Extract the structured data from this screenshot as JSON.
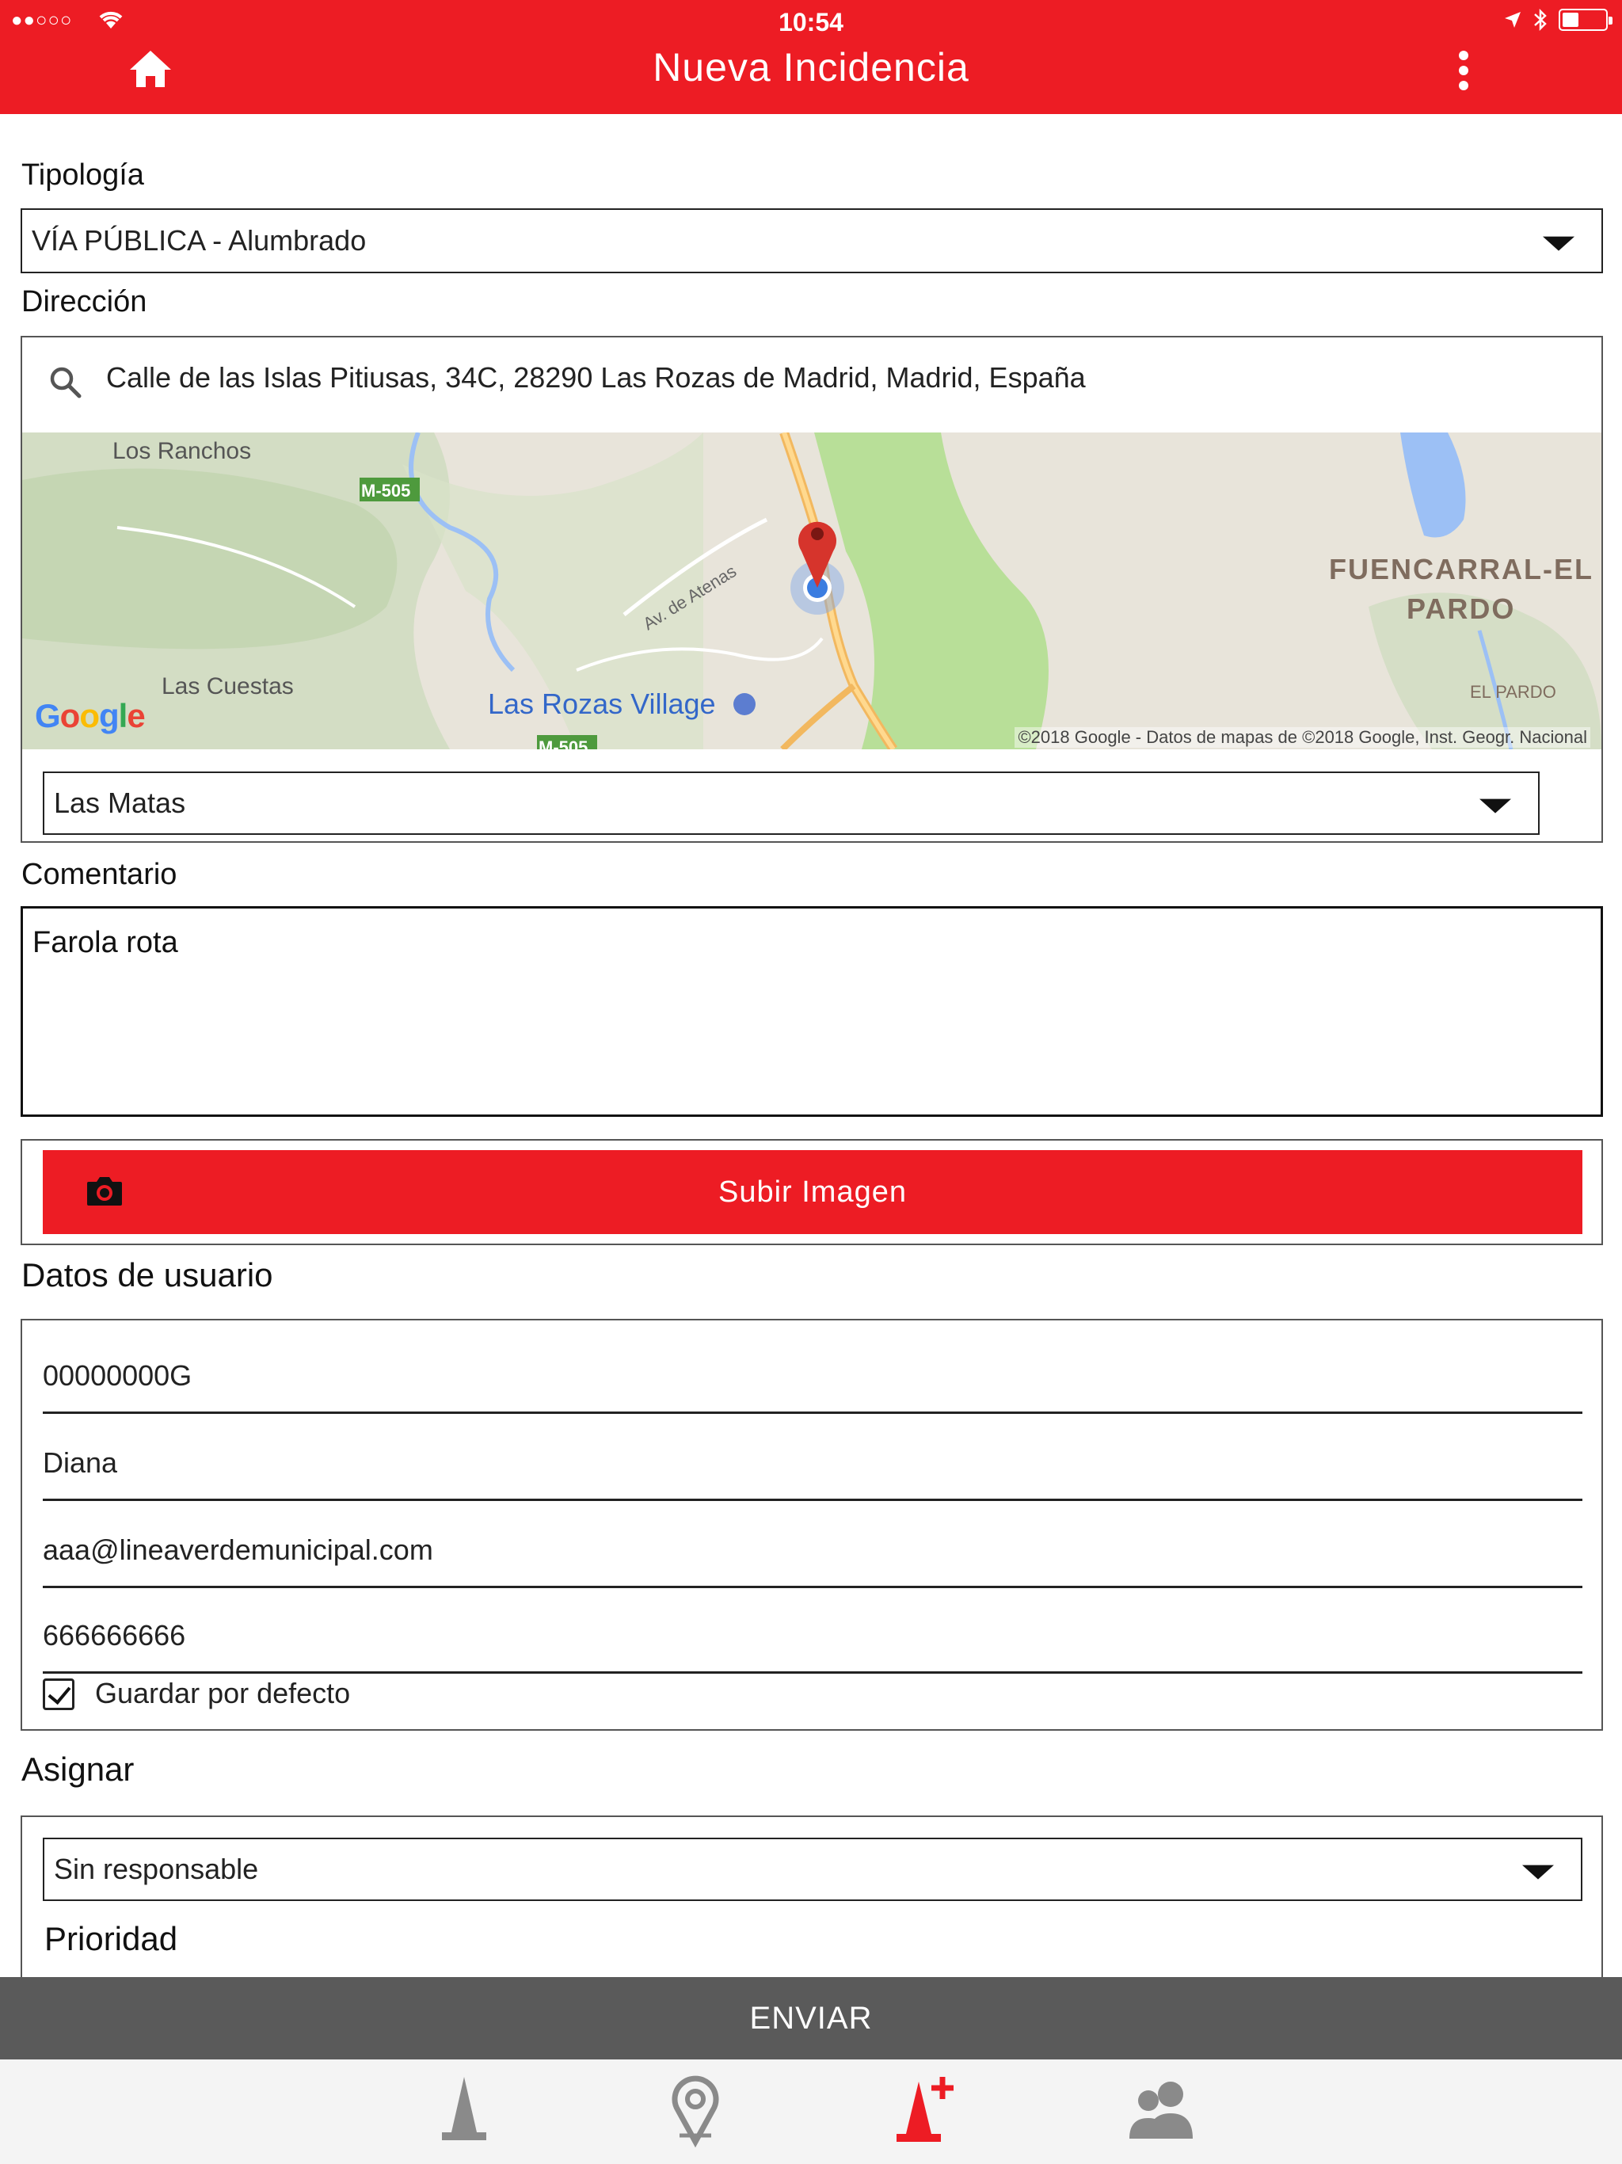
{
  "status_bar": {
    "time": "10:54",
    "signal": "●●○○○"
  },
  "header": {
    "title": "Nueva Incidencia",
    "home_icon": "home-icon",
    "menu_icon": "more-vertical-icon"
  },
  "form": {
    "tipologia_label": "Tipología",
    "tipologia_value": "VÍA PÚBLICA - Alumbrado",
    "direccion_label": "Dirección",
    "direccion_value": "Calle de las Islas Pitiusas, 34C, 28290 Las Rozas de Madrid, Madrid, España",
    "map": {
      "labels": [
        "Los Ranchos",
        "M-505",
        "Las Cuestas",
        "Av. de Atenas",
        "Las Rozas Village",
        "FUENCARRAL-EL",
        "PARDO",
        "EL PARDO",
        "M-505"
      ],
      "logo": "Google",
      "attribution": "©2018 Google - Datos de mapas de ©2018 Google, Inst. Geogr. Nacional"
    },
    "zona_value": "Las Matas",
    "comentario_label": "Comentario",
    "comentario_value": "Farola rota",
    "upload_label": "Subir Imagen",
    "datos_label": "Datos de usuario",
    "user_fields": [
      "00000000G",
      "Diana",
      "aaa@lineaverdemunicipal.com",
      "666666666"
    ],
    "guardar_label": "Guardar por defecto",
    "guardar_checked": true,
    "asignar_label": "Asignar",
    "asignar_value": "Sin responsable",
    "prioridad_label": "Prioridad"
  },
  "send_label": "ENVIAR",
  "tabs": [
    {
      "icon": "cone-icon",
      "active": false
    },
    {
      "icon": "location-pin-icon",
      "active": false
    },
    {
      "icon": "add-incident-icon",
      "active": true
    },
    {
      "icon": "users-icon",
      "active": false
    }
  ],
  "colors": {
    "accent": "#ed1c24",
    "send_bar": "#5a5a5a",
    "tab_inactive": "#8a8a8a"
  }
}
